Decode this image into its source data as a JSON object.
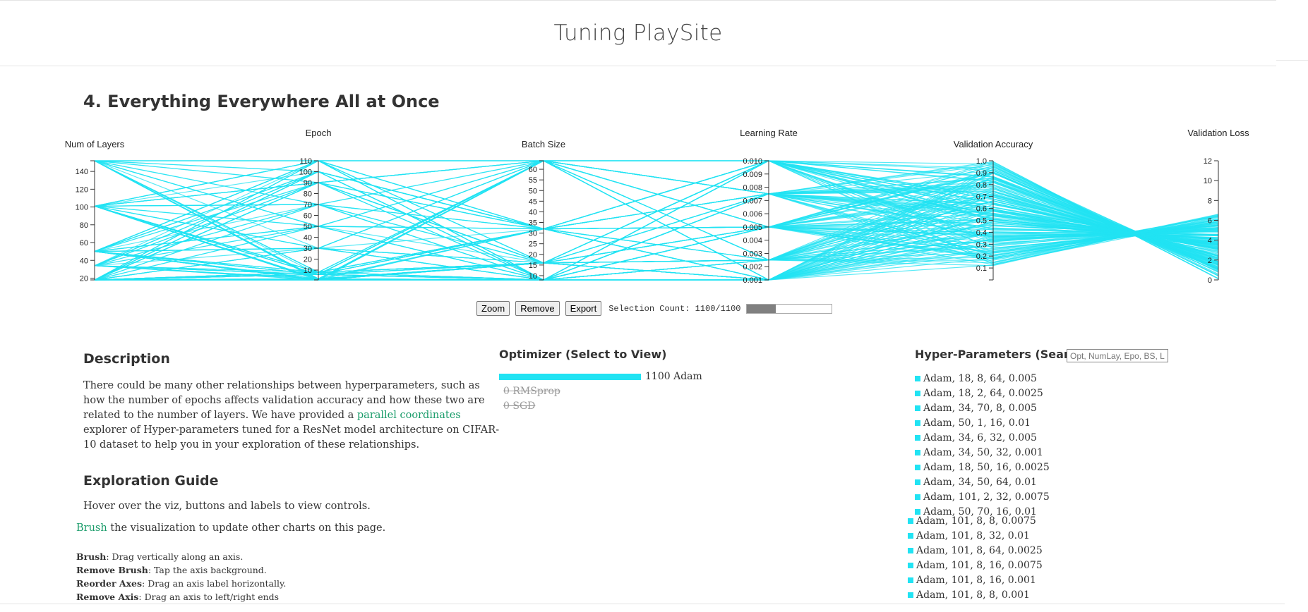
{
  "site": {
    "title": "Tuning PlaySite"
  },
  "section": {
    "title": "4. Everything Everywhere All at Once"
  },
  "colors": {
    "line": "#21e3f3",
    "link": "#1a9c6a",
    "progress": "#808080"
  },
  "parallel_coordinates": {
    "axes": [
      {
        "title": "Num of Layers",
        "ticks": [
          "20",
          "40",
          "60",
          "80",
          "100",
          "120",
          "140"
        ],
        "min": 18,
        "max": 152
      },
      {
        "title": "Epoch",
        "ticks": [
          "10",
          "20",
          "30",
          "40",
          "50",
          "60",
          "70",
          "80",
          "90",
          "100",
          "110"
        ],
        "min": 1,
        "max": 110
      },
      {
        "title": "Batch Size",
        "ticks": [
          "10",
          "15",
          "20",
          "25",
          "30",
          "35",
          "40",
          "45",
          "50",
          "55",
          "60"
        ],
        "min": 8,
        "max": 64
      },
      {
        "title": "Learning Rate",
        "ticks": [
          "0.001",
          "0.002",
          "0.003",
          "0.004",
          "0.005",
          "0.006",
          "0.007",
          "0.008",
          "0.009",
          "0.010"
        ],
        "min": 0.001,
        "max": 0.01
      },
      {
        "title": "Validation Accuracy",
        "ticks": [
          "0.1",
          "0.2",
          "0.3",
          "0.4",
          "0.5",
          "0.6",
          "0.7",
          "0.8",
          "0.9",
          "1.0"
        ],
        "min": 0,
        "max": 1.0
      },
      {
        "title": "Validation Loss",
        "ticks": [
          "0",
          "2",
          "4",
          "6",
          "8",
          "10",
          "12"
        ],
        "min": 0,
        "max": 12
      }
    ]
  },
  "controls": {
    "zoom_label": "Zoom",
    "remove_label": "Remove",
    "export_label": "Export",
    "selection_text": "Selection Count: 1100/1100",
    "selection_progress": 0.34
  },
  "description": {
    "title": "Description",
    "text_before_link": "There could be many other relationships between hyperparameters, such as how the number of epochs affects validation accuracy and how these two are related to the number of layers. We have provided a ",
    "link_text": "parallel coordinates",
    "text_after_link": " explorer of Hyper-parameters tuned for a ResNet model architecture on CIFAR-10 dataset to help you in your exploration of these relationships."
  },
  "guide": {
    "title": "Exploration Guide",
    "hover_text": "Hover over the viz, buttons and labels to view controls.",
    "brush_link": "Brush",
    "brush_text": " the visualization to update other charts on this page.",
    "items": [
      {
        "key": "Brush",
        "text": ": Drag vertically along an axis."
      },
      {
        "key": "Remove Brush",
        "text": ": Tap the axis background."
      },
      {
        "key": "Reorder Axes",
        "text": ": Drag an axis label horizontally."
      },
      {
        "key": "Remove Axis",
        "text": ": Drag an axis to left/right ends"
      }
    ]
  },
  "optimizer": {
    "title": "Optimizer (Select to View)",
    "items": [
      {
        "label": "1100 Adam",
        "count": 1100,
        "active": true
      },
      {
        "label": "0 RMSprop",
        "count": 0,
        "active": false
      },
      {
        "label": "0 SGD",
        "count": 0,
        "active": false
      }
    ]
  },
  "hyperparams": {
    "title": "Hyper-Parameters (Search)",
    "search_placeholder": "Opt, NumLay, Epo, BS, LR",
    "items": [
      "Adam, 18, 8, 64, 0.005",
      "Adam, 18, 2, 64, 0.0025",
      "Adam, 34, 70, 8, 0.005",
      "Adam, 50, 1, 16, 0.01",
      "Adam, 34, 6, 32, 0.005",
      "Adam, 34, 50, 32, 0.001",
      "Adam, 18, 50, 16, 0.0025",
      "Adam, 34, 50, 64, 0.01",
      "Adam, 101, 2, 32, 0.0075",
      "Adam, 50, 70, 16, 0.01"
    ],
    "items_more": [
      "Adam, 101, 8, 8, 0.0075",
      "Adam, 101, 8, 32, 0.01",
      "Adam, 101, 8, 64, 0.0025",
      "Adam, 101, 8, 16, 0.0075",
      "Adam, 101, 8, 16, 0.001",
      "Adam, 101, 8, 8, 0.001"
    ]
  }
}
